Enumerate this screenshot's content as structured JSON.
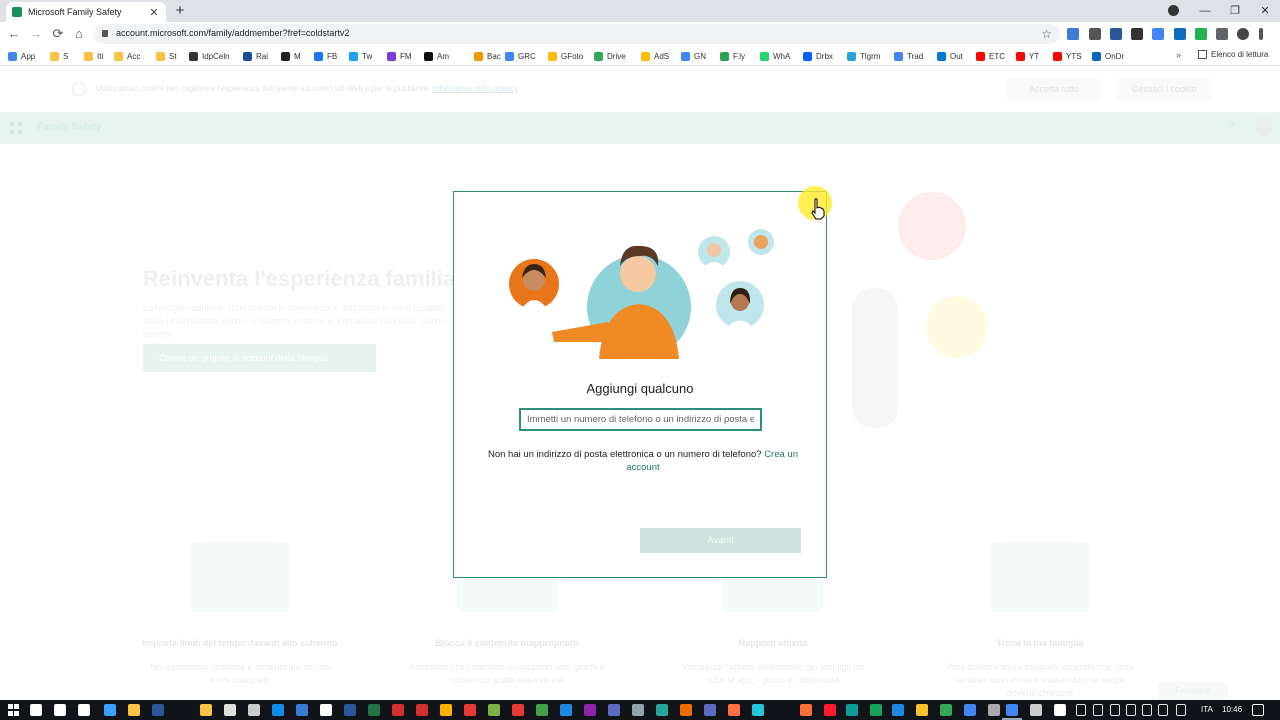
{
  "browser": {
    "tab_title": "Microsoft Family Safety",
    "tab_close": "✕",
    "new_tab": "+",
    "url": "account.microsoft.com/family/addmember?fref=coldstartv2",
    "star": "☆",
    "win_min": "—",
    "win_restore": "❐",
    "win_close": "✕",
    "back": "←",
    "forward": "→",
    "reload": "⟳",
    "home": "⌂"
  },
  "bookmarks": {
    "apps_label": "App",
    "items": [
      {
        "label": "S",
        "color": "#f6c343"
      },
      {
        "label": "Iti",
        "color": "#f6c343"
      },
      {
        "label": "Acc",
        "color": "#f6c343"
      },
      {
        "label": "St",
        "color": "#f6c343"
      },
      {
        "label": "IdpCeln",
        "color": "#333333"
      },
      {
        "label": "Rai",
        "color": "#1b4f9c"
      },
      {
        "label": "M",
        "color": "#222222"
      },
      {
        "label": "FB",
        "color": "#1877f2"
      },
      {
        "label": "Tw",
        "color": "#1da1f2"
      },
      {
        "label": "FM",
        "color": "#7b3fe4"
      },
      {
        "label": "Am",
        "color": "#111111"
      },
      {
        "label": "Bac",
        "color": "#f29900"
      },
      {
        "label": "GRC",
        "color": "#4285f4"
      },
      {
        "label": "GFoto",
        "color": "#fbbc04"
      },
      {
        "label": "Drive",
        "color": "#34a853"
      },
      {
        "label": "AdS",
        "color": "#fbbc04"
      },
      {
        "label": "GN",
        "color": "#4285f4"
      },
      {
        "label": "F.ly",
        "color": "#2ea44f"
      },
      {
        "label": "WhA",
        "color": "#25d366"
      },
      {
        "label": "Drbx",
        "color": "#0061ff"
      },
      {
        "label": "Tlgrm",
        "color": "#2aa1da"
      },
      {
        "label": "Trad",
        "color": "#4285f4"
      },
      {
        "label": "Out",
        "color": "#0078d4"
      },
      {
        "label": "ETC",
        "color": "#ff0000"
      },
      {
        "label": "YT",
        "color": "#ff0000"
      },
      {
        "label": "YTS",
        "color": "#ff0000"
      },
      {
        "label": "OnDr",
        "color": "#0a66c2"
      }
    ],
    "overflow": "»",
    "reading_list": "Elenco di lettura"
  },
  "page": {
    "cookie_message": "Utilizziamo i cookie per migliorare l'esperienza dell'utente sui nostri siti Web e per la pubblicità.",
    "cookie_link": "Informativa sulla privacy",
    "cookie_accept": "Accetta tutto",
    "cookie_manage": "Gestisci i cookie",
    "app_name": "Family Safety",
    "help": "?",
    "hero_title": "Reinventa l'esperienza familiare",
    "hero_subtitle": "Le famiglie moderne sono di tutte le dimensioni e distribuite in varie località. Aiuta i tuoi bambini online, a divertirsi insieme e a rimanere connessi, anche quando",
    "hero_cta": "Creare un gruppo di account della famiglia",
    "features": [
      {
        "title": "Imposta limiti del tempo davanti allo schermo",
        "desc": "No discussioni. Imposta e dimenticala con un limite bilanciato"
      },
      {
        "title": "Blocca il contenuto inappropriato",
        "desc": "Assicurati che i bambini visualizzino solo giochi e contenuto adatti alla loro età"
      },
      {
        "title": "Rapporti attività",
        "desc": "Visualizza l'attività settimanale dei tuoi figli tra tutte le app, i giochi e i dispositivi"
      },
      {
        "title": "Trova la tua famiglia",
        "desc": "Puoi dormire sonni tranquilli sapendo che i tuoi familiari sono arrivati a destinazione senza doverlo chiedere"
      }
    ],
    "feedback": "Feedback"
  },
  "modal": {
    "title": "Aggiungi qualcuno",
    "input_placeholder": "Immetti un numero di telefono o un indirizzo di posta elettronica",
    "hint_text": "Non hai un indirizzo di posta elettronica o un numero di telefono?",
    "hint_link": "Crea un account",
    "next_button": "Avanti",
    "accent": "#2f8f7b"
  },
  "taskbar": {
    "lang": "ITA",
    "time": "10:46"
  }
}
